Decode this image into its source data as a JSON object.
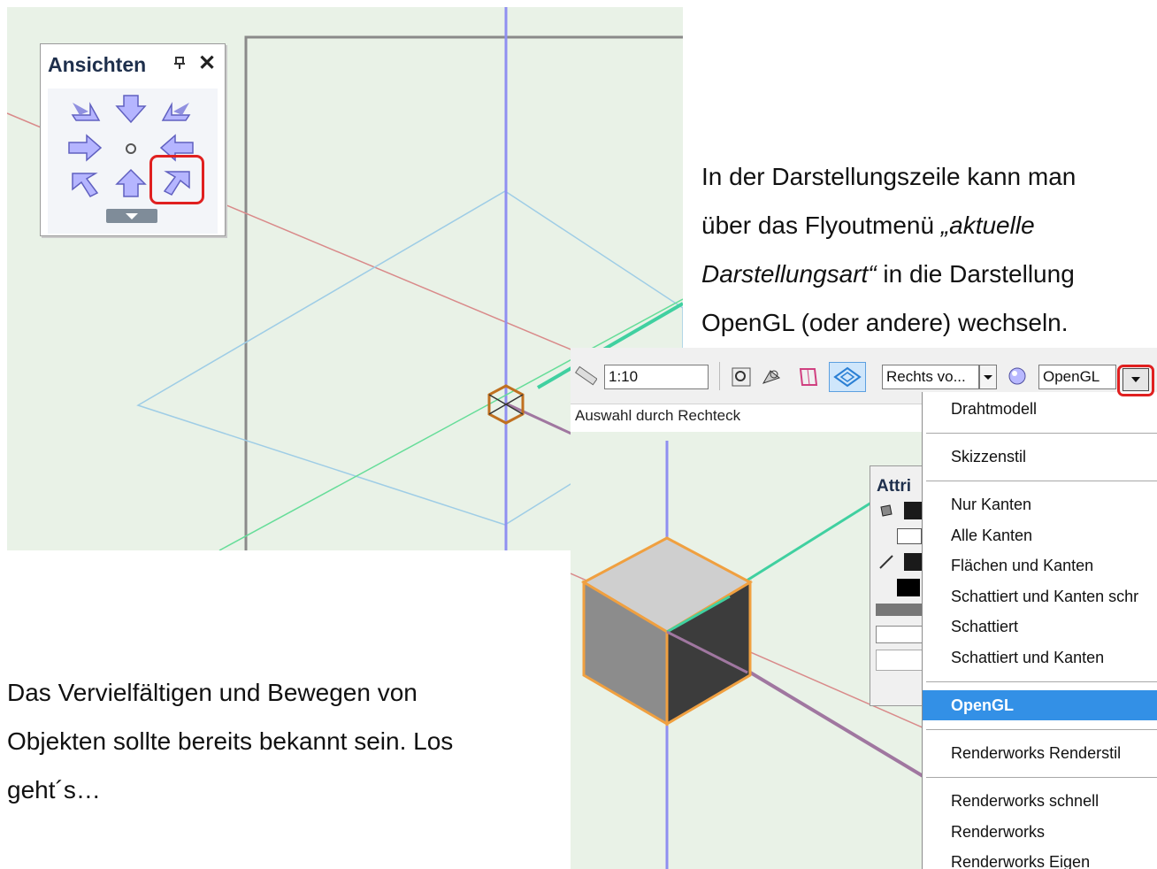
{
  "palette": {
    "title": "Ansichten",
    "pin_icon": "pin-icon",
    "close_glyph": "✕",
    "buttons": [
      "view-front-left-icon",
      "view-front-icon",
      "view-front-right-icon",
      "view-left-icon",
      "view-top-icon",
      "view-right-icon",
      "view-back-left-icon",
      "view-back-icon",
      "view-back-right-icon"
    ],
    "highlighted": "view-back-right-icon"
  },
  "caption_top": {
    "line1": "In der Darstellungszeile kann man",
    "line2_prefix": "über das Flyoutmenü ",
    "line2_italic": "„aktuelle",
    "line3_italic": "Darstellungsart“",
    "line3_suffix": " in die Darstellung",
    "line4": "OpenGL (oder andere) wechseln."
  },
  "caption_bottom": {
    "line1": "Das Vervielfältigen und Bewegen von",
    "line2": "Objekten sollte bereits bekannt sein. Los",
    "line3": "geht´s…"
  },
  "toolbar": {
    "scale_value": "1:10",
    "view_select": "Rechts vo...",
    "render_select": "OpenGL",
    "status": "Auswahl durch Rechteck"
  },
  "attributes_panel": {
    "title": "Attri"
  },
  "render_menu": {
    "items": [
      "Drahtmodell",
      "Skizzenstil",
      "Nur Kanten",
      "Alle Kanten",
      "Flächen und Kanten",
      "Schattiert und Kanten schr",
      "Schattiert",
      "Schattiert und Kanten",
      "OpenGL",
      "Renderworks Renderstil",
      "Renderworks schnell",
      "Renderworks",
      "Renderworks Eigen"
    ],
    "selected": "OpenGL"
  },
  "colors": {
    "viewport_bg": "#e9f2e7",
    "highlight_red": "#e02020",
    "menu_selected": "#3390e6",
    "cube_outline": "#f0a040"
  }
}
